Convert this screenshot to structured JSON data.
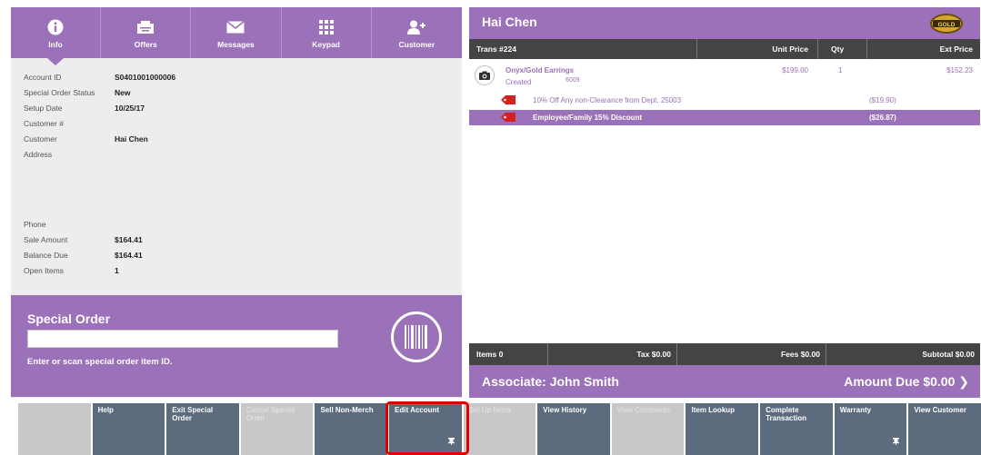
{
  "tabs": [
    {
      "label": "Info",
      "icon": "info-icon",
      "active": true
    },
    {
      "label": "Offers",
      "icon": "offers-icon"
    },
    {
      "label": "Messages",
      "icon": "envelope-icon"
    },
    {
      "label": "Keypad",
      "icon": "keypad-icon"
    },
    {
      "label": "Customer",
      "icon": "add-customer-icon"
    }
  ],
  "info": {
    "account_id_label": "Account ID",
    "account_id": "S0401001000006",
    "so_status_label": "Special Order Status",
    "so_status": "New",
    "setup_date_label": "Setup Date",
    "setup_date": "10/25/17",
    "customer_num_label": "Customer #",
    "customer_label": "Customer",
    "customer": "Hai Chen",
    "address_label": "Address",
    "phone_label": "Phone",
    "sale_amount_label": "Sale Amount",
    "sale_amount": "$164.41",
    "balance_due_label": "Balance Due",
    "balance_due": "$164.41",
    "open_items_label": "Open Items",
    "open_items": "1"
  },
  "special_order": {
    "title": "Special Order",
    "input_value": "",
    "hint": "Enter or scan special order item ID."
  },
  "transaction": {
    "customer_name": "Hai Chen",
    "badge_text": "GOLD",
    "columns": {
      "trans": "Trans #224",
      "unit_price": "Unit Price",
      "qty": "Qty",
      "ext_price": "Ext Price"
    },
    "item": {
      "name": "Onyx/Gold Earrings",
      "status": "Created",
      "sku": "6009",
      "unit_price": "$199.00",
      "qty": "1",
      "ext_price": "$152.23"
    },
    "discounts": [
      {
        "label": "10% Off Any non-Clearance from Dept. 25003",
        "amount": "($19.90)"
      },
      {
        "label": "Employee/Family 15% Discount",
        "amount": "($26.87)"
      }
    ],
    "footer": {
      "items": "Items 0",
      "tax": "Tax $0.00",
      "fees": "Fees $0.00",
      "subtotal": "Subtotal $0.00"
    },
    "associate": "Associate: John Smith",
    "amount_due": "Amount Due  $0.00  ❯"
  },
  "bottom_buttons": [
    {
      "label": "",
      "state": "empty"
    },
    {
      "label": "Help",
      "state": "enabled"
    },
    {
      "label": "Exit Special Order",
      "state": "enabled"
    },
    {
      "label": "Cancel Special Order",
      "state": "disabled"
    },
    {
      "label": "Sell Non-Merch",
      "state": "enabled"
    },
    {
      "label": "Edit Account",
      "state": "enabled",
      "pin": true,
      "highlighted": true
    },
    {
      "label": "Set Up Items",
      "state": "disabled"
    },
    {
      "label": "View History",
      "state": "enabled"
    },
    {
      "label": "View Comments",
      "state": "disabled"
    },
    {
      "label": "Item Lookup",
      "state": "enabled"
    },
    {
      "label": "Complete Transaction",
      "state": "enabled"
    },
    {
      "label": "Warranty",
      "state": "enabled",
      "pin": true
    },
    {
      "label": "View Customer",
      "state": "enabled"
    }
  ],
  "colors": {
    "accent_purple": "#9b71b9",
    "dark_bar": "#444444",
    "button_slate": "#5c6b7d",
    "button_disabled": "#c8c8c8",
    "highlight_red": "#e00000"
  }
}
